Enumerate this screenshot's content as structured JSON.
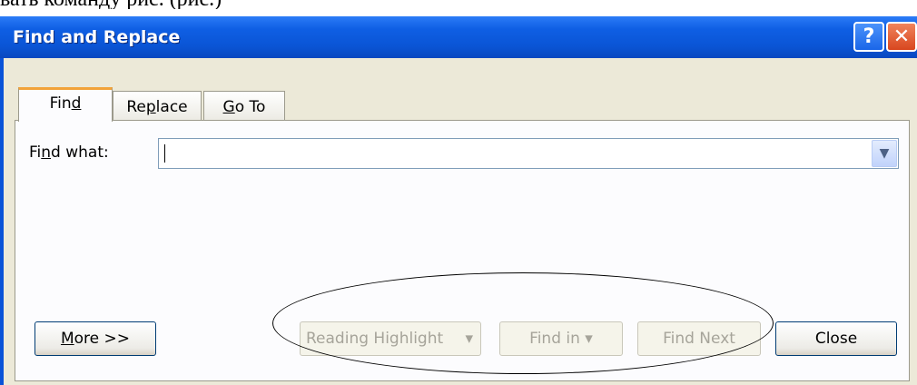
{
  "caption_text": "вать команду рис. (рис.)",
  "dialog": {
    "title": "Find and Replace",
    "help_glyph": "?",
    "close_glyph": "✕"
  },
  "tabs": [
    {
      "label_pre": "Fin",
      "label_key": "d",
      "label_post": "",
      "active": true
    },
    {
      "label_pre": "Re",
      "label_key": "p",
      "label_post": "lace",
      "active": false
    },
    {
      "label_pre": "",
      "label_key": "G",
      "label_post": "o To",
      "active": false
    }
  ],
  "find": {
    "label_pre": "Fi",
    "label_key": "n",
    "label_post": "d what:",
    "value": "",
    "dropdown_glyph": "▼"
  },
  "buttons": {
    "more_key": "M",
    "more_post": "ore >>",
    "reading_highlight": "Reading Highlight",
    "reading_highlight_arrow": "▾",
    "find_in": "Find in",
    "find_in_arrow": "▾",
    "find_next": "Find Next",
    "close": "Close"
  }
}
